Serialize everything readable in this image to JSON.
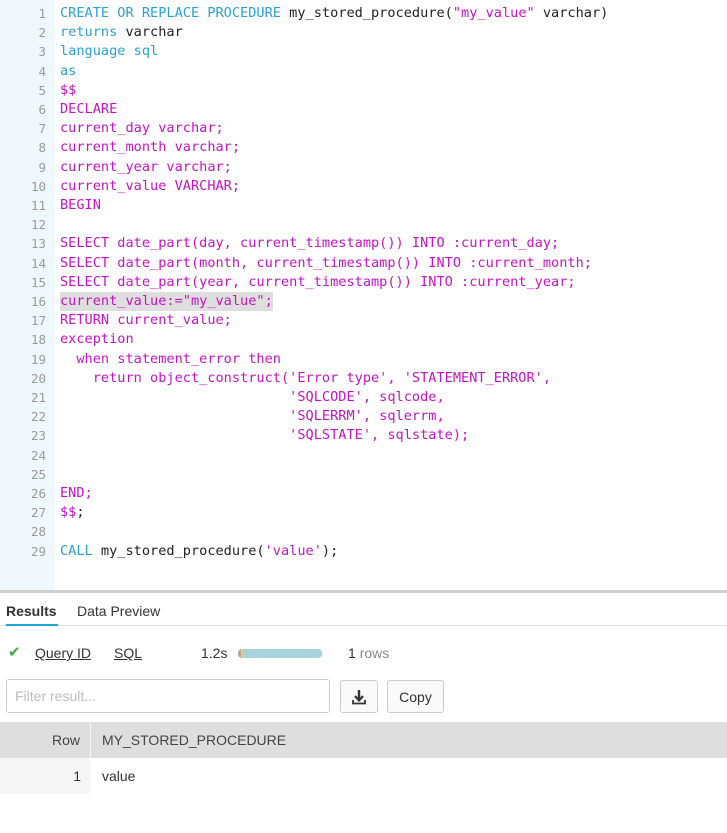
{
  "editor": {
    "highlighted_line": 16,
    "lines": [
      {
        "n": "1",
        "tokens": [
          {
            "t": "CREATE OR REPLACE PROCEDURE ",
            "c": "kw"
          },
          {
            "t": "my_stored_procedure(",
            "c": "tx"
          },
          {
            "t": "\"my_value\"",
            "c": "st"
          },
          {
            "t": " varchar)",
            "c": "tx"
          }
        ]
      },
      {
        "n": "2",
        "tokens": [
          {
            "t": "returns ",
            "c": "kw"
          },
          {
            "t": "varchar",
            "c": "tx"
          }
        ]
      },
      {
        "n": "3",
        "tokens": [
          {
            "t": "language sql",
            "c": "kw"
          }
        ]
      },
      {
        "n": "4",
        "tokens": [
          {
            "t": "as",
            "c": "kw"
          }
        ]
      },
      {
        "n": "5",
        "tokens": [
          {
            "t": "$$",
            "c": "pl"
          }
        ]
      },
      {
        "n": "6",
        "tokens": [
          {
            "t": "DECLARE",
            "c": "pl"
          }
        ]
      },
      {
        "n": "7",
        "tokens": [
          {
            "t": "current_day varchar;",
            "c": "pl"
          }
        ]
      },
      {
        "n": "8",
        "tokens": [
          {
            "t": "current_month varchar;",
            "c": "pl"
          }
        ]
      },
      {
        "n": "9",
        "tokens": [
          {
            "t": "current_year varchar;",
            "c": "pl"
          }
        ]
      },
      {
        "n": "10",
        "tokens": [
          {
            "t": "current_value VARCHAR;",
            "c": "pl"
          }
        ]
      },
      {
        "n": "11",
        "tokens": [
          {
            "t": "BEGIN",
            "c": "pl"
          }
        ]
      },
      {
        "n": "12",
        "tokens": []
      },
      {
        "n": "13",
        "tokens": [
          {
            "t": "SELECT date_part(day, current_timestamp()) INTO :current_day;",
            "c": "pl"
          }
        ]
      },
      {
        "n": "14",
        "tokens": [
          {
            "t": "SELECT date_part(month, current_timestamp()) INTO :current_month;",
            "c": "pl"
          }
        ]
      },
      {
        "n": "15",
        "tokens": [
          {
            "t": "SELECT date_part(year, current_timestamp()) INTO :current_year;",
            "c": "pl"
          }
        ]
      },
      {
        "n": "16",
        "tokens": [
          {
            "t": "current_value:=\"my_value\";",
            "c": "pl"
          }
        ]
      },
      {
        "n": "17",
        "tokens": [
          {
            "t": "RETURN current_value;",
            "c": "pl"
          }
        ]
      },
      {
        "n": "18",
        "tokens": [
          {
            "t": "exception",
            "c": "pl"
          }
        ]
      },
      {
        "n": "19",
        "tokens": [
          {
            "t": "  when statement_error then",
            "c": "pl"
          }
        ]
      },
      {
        "n": "20",
        "tokens": [
          {
            "t": "    return object_construct('Error type', 'STATEMENT_ERROR',",
            "c": "pl"
          }
        ]
      },
      {
        "n": "21",
        "tokens": [
          {
            "t": "                            'SQLCODE', sqlcode,",
            "c": "pl"
          }
        ]
      },
      {
        "n": "22",
        "tokens": [
          {
            "t": "                            'SQLERRM', sqlerrm,",
            "c": "pl"
          }
        ]
      },
      {
        "n": "23",
        "tokens": [
          {
            "t": "                            'SQLSTATE', sqlstate);",
            "c": "pl"
          }
        ]
      },
      {
        "n": "24",
        "tokens": []
      },
      {
        "n": "25",
        "tokens": []
      },
      {
        "n": "26",
        "tokens": [
          {
            "t": "END;",
            "c": "pl"
          }
        ]
      },
      {
        "n": "27",
        "tokens": [
          {
            "t": "$$",
            "c": "pl"
          },
          {
            "t": ";",
            "c": "tx"
          }
        ]
      },
      {
        "n": "28",
        "tokens": []
      },
      {
        "n": "29",
        "tokens": [
          {
            "t": "CALL ",
            "c": "kw"
          },
          {
            "t": "my_stored_procedure(",
            "c": "tx"
          },
          {
            "t": "'value'",
            "c": "st"
          },
          {
            "t": ");",
            "c": "tx"
          }
        ]
      }
    ]
  },
  "results_panel": {
    "tabs": [
      {
        "label": "Results",
        "active": true
      },
      {
        "label": "Data Preview",
        "active": false
      }
    ],
    "status": {
      "icon": "check-icon",
      "query_id_label": "Query ID",
      "sql_label": "SQL",
      "duration": "1.2s",
      "progress": {
        "compile_fraction": 0.04,
        "queue_fraction": 0.02,
        "execution_fraction": 0.94
      },
      "row_count": "1",
      "row_label": "rows"
    },
    "filter": {
      "placeholder": "Filter result...",
      "value": ""
    },
    "download_icon": "download-icon",
    "copy_label": "Copy",
    "table": {
      "row_header": "Row",
      "columns": [
        "MY_STORED_PROCEDURE"
      ],
      "rows": [
        {
          "row": "1",
          "values": [
            "value"
          ]
        }
      ]
    }
  },
  "colors": {
    "keyword": "#29a2cf",
    "plsql": "#c414c4",
    "text": "#222222",
    "accent": "#1aa6d8",
    "success": "#3eaa47",
    "progress": "#a6d3dc"
  }
}
